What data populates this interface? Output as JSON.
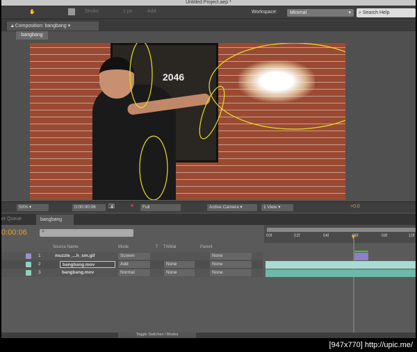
{
  "window": {
    "title": "Untitled Project.aep *"
  },
  "toolbar": {
    "stroke_label": "Stroke",
    "px_value": "1 px",
    "add_label": "Add",
    "workspace_label": "Workspace:",
    "workspace_value": "Minimal",
    "search_placeholder": "Search Help"
  },
  "composition_panel": {
    "tab_label": "Composition: bangbang",
    "sub_tab": "bangbang"
  },
  "video": {
    "poster_text": "2046"
  },
  "viewer_toolbar": {
    "zoom": "50%",
    "timecode": "0:00:00:06",
    "resolution": "Full",
    "camera": "Active Camera",
    "views": "1 View",
    "exposure": "+0.0"
  },
  "timeline": {
    "tabs": [
      "er Queue",
      "bangbang"
    ],
    "current_time": "0:00:06",
    "ruler": [
      "00f",
      "02f",
      "04f",
      "06f",
      "08f",
      "10f"
    ],
    "columns": {
      "source_name": "Source Name",
      "mode": "Mode",
      "t": "T",
      "trkmat": "TrkMat",
      "parent": "Parent"
    },
    "layers": [
      {
        "num": "1",
        "name": "muzzle_...h_sm.gif",
        "mode": "Screen",
        "trkmat": "",
        "parent": "None",
        "color": "#9a92d0"
      },
      {
        "num": "2",
        "name": "bangbang.mov",
        "mode": "Add",
        "trkmat": "None",
        "parent": "None",
        "color": "#8ed0c0"
      },
      {
        "num": "3",
        "name": "bangbang.mov",
        "mode": "Normal",
        "trkmat": "None",
        "parent": "None",
        "color": "#8ed0c0"
      }
    ],
    "toggle_label": "Toggle Switches / Modes"
  },
  "footer": {
    "watermark": "[947x770] http://upic.me/"
  }
}
